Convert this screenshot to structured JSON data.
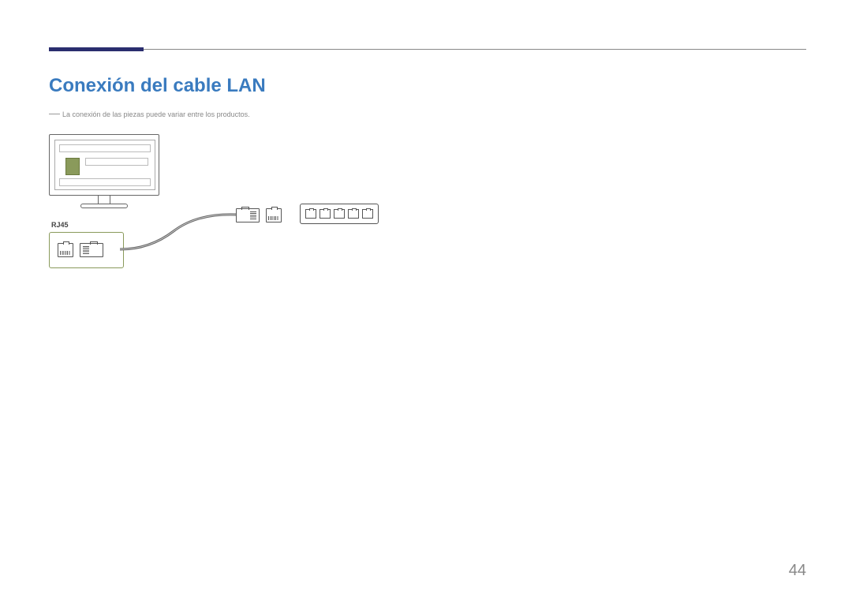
{
  "title": "Conexión del cable LAN",
  "note": "La conexión de las piezas puede variar entre los productos.",
  "connector_label": "RJ45",
  "page_number": "44"
}
